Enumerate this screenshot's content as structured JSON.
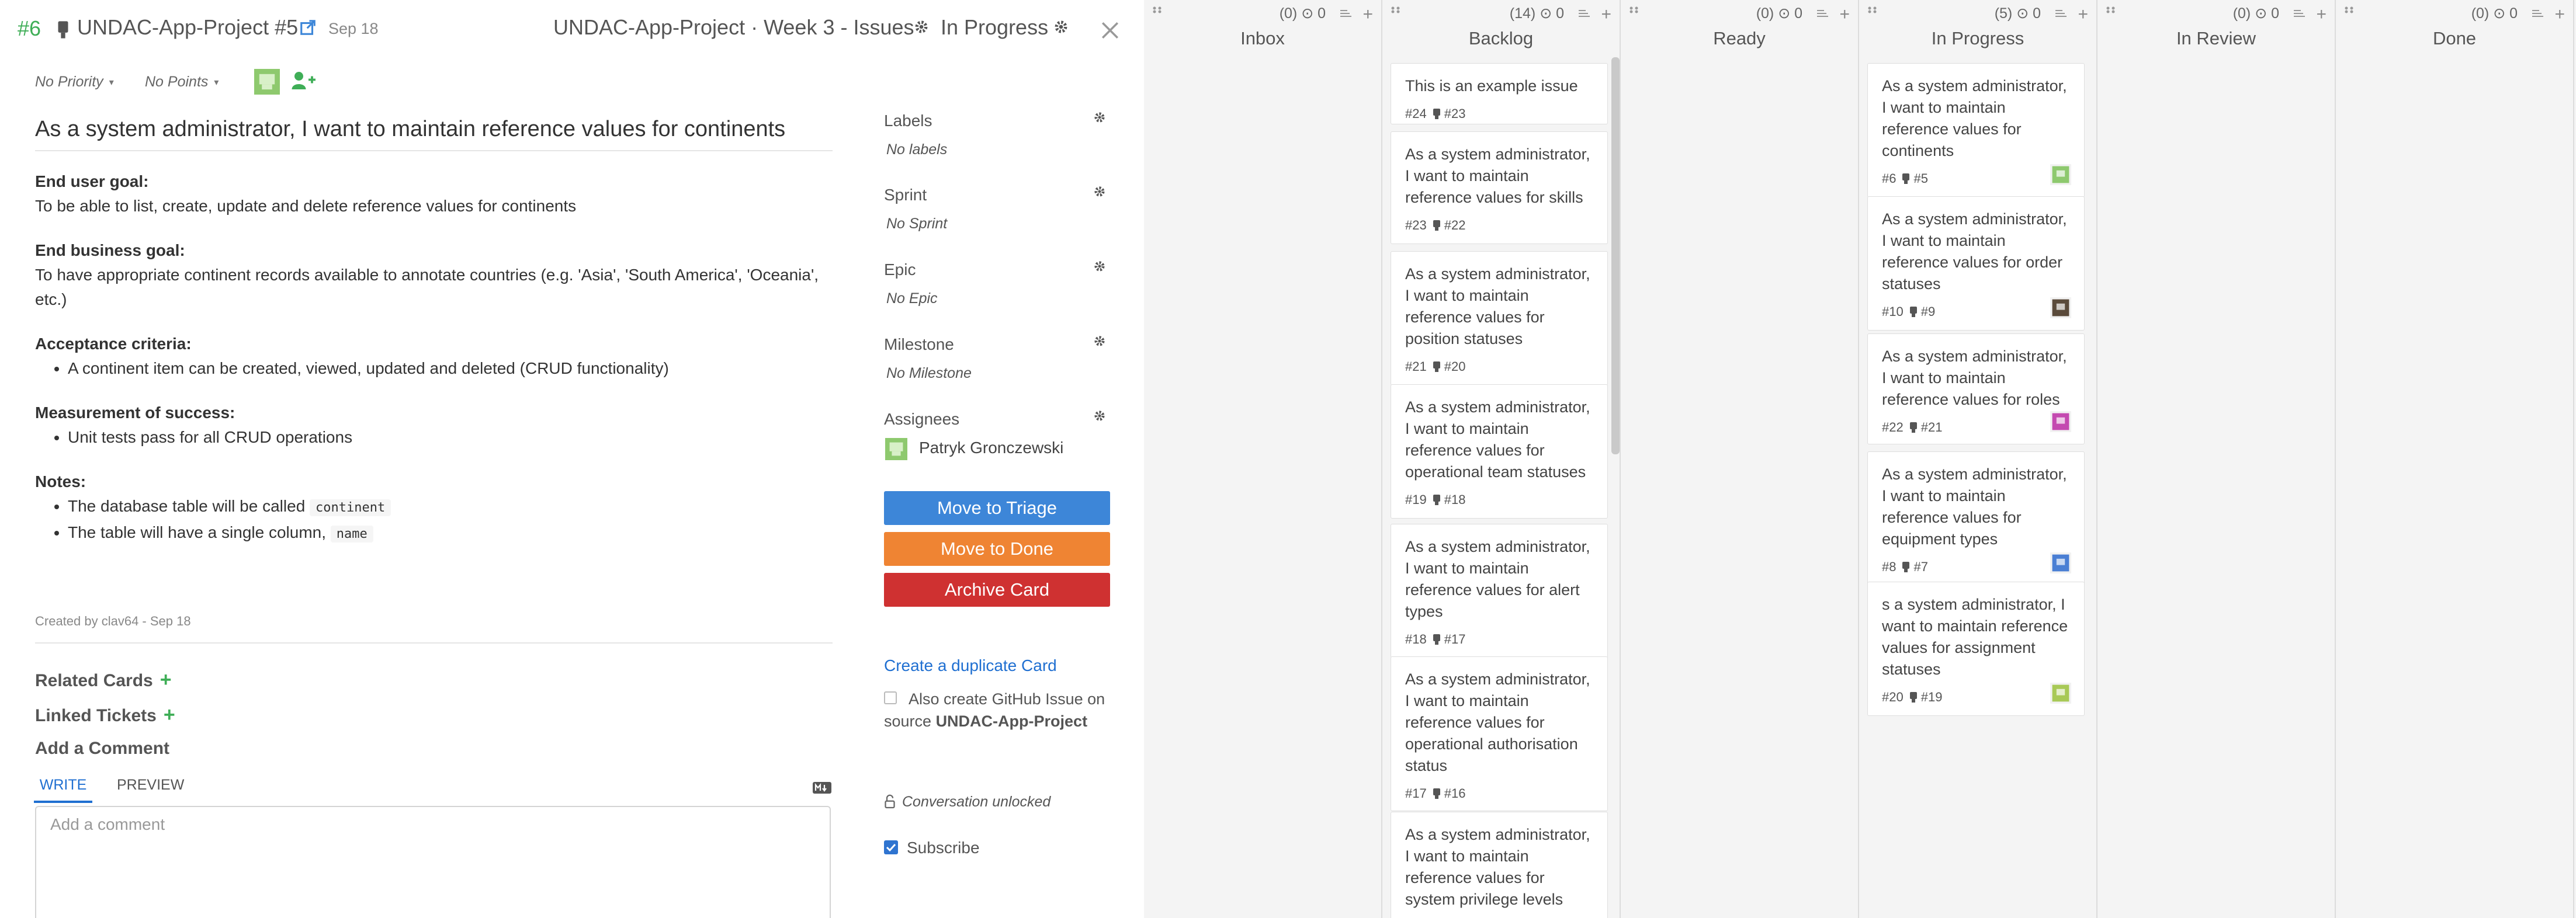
{
  "header": {
    "issue_number": "#6",
    "repo": "UNDAC-App-Project #5",
    "date": "Sep 18",
    "sprint": "UNDAC-App-Project · Week 3 - Issues",
    "status": "In Progress"
  },
  "meta": {
    "priority": "No Priority",
    "points": "No Points"
  },
  "issue": {
    "title": "As a system administrator, I want to maintain reference values for continents",
    "h_user_goal": "End user goal:",
    "user_goal": "To be able to list, create, update and delete reference values for continents",
    "h_business_goal": "End business goal:",
    "business_goal": "To have appropriate continent records available to annotate countries (e.g. 'Asia', 'South America', 'Oceania', etc.)",
    "h_acceptance": "Acceptance criteria:",
    "acceptance_1": "A continent item can be created, viewed, updated and deleted (CRUD functionality)",
    "h_measurement": "Measurement of success:",
    "measurement_1": "Unit tests pass for all CRUD operations",
    "h_notes": "Notes:",
    "note_1_text": "The database table will be called",
    "note_1_code": "continent",
    "note_2_text": "The table will have a single column,",
    "note_2_code": "name",
    "created": "Created by clav64 - Sep 18"
  },
  "sections": {
    "related": "Related Cards",
    "linked": "Linked Tickets",
    "add_comment": "Add a Comment"
  },
  "comment": {
    "tab_write": "WRITE",
    "tab_preview": "PREVIEW",
    "placeholder": "Add a comment"
  },
  "sidebar": {
    "labels_label": "Labels",
    "labels_value": "No labels",
    "sprint_label": "Sprint",
    "sprint_value": "No Sprint",
    "epic_label": "Epic",
    "epic_value": "No Epic",
    "milestone_label": "Milestone",
    "milestone_value": "No Milestone",
    "assignees_label": "Assignees",
    "assignee": "Patryk Gronczewski"
  },
  "actions": {
    "triage": "Move to Triage",
    "done": "Move to Done",
    "archive": "Archive Card",
    "duplicate": "Create a duplicate Card",
    "github_text": "Also create GitHub Issue on source",
    "github_repo": "UNDAC-App-Project",
    "unlocked": "Conversation unlocked",
    "subscribe": "Subscribe"
  },
  "colors": {
    "accent_green": "#3fae57",
    "link_blue": "#1f6fd1",
    "btn_blue": "#3d86d8",
    "btn_orange": "#ef8433",
    "btn_red": "#cf3131"
  },
  "columns": [
    {
      "name": "Inbox",
      "counts": "(0) ⊙ 0",
      "cards": []
    },
    {
      "name": "Backlog",
      "counts": "(14) ⊙ 0",
      "cards": [
        {
          "title": "This is an example issue",
          "num": "#24",
          "pr": "#23"
        },
        {
          "title": "As a system administrator, I want to maintain reference values for skills",
          "num": "#23",
          "pr": "#22"
        },
        {
          "title": "As a system administrator, I want to maintain reference values for position statuses",
          "num": "#21",
          "pr": "#20"
        },
        {
          "title": "As a system administrator, I want to maintain reference values for operational team statuses",
          "num": "#19",
          "pr": "#18"
        },
        {
          "title": "As a system administrator, I want to maintain reference values for alert types",
          "num": "#18",
          "pr": "#17"
        },
        {
          "title": "As a system administrator, I want to maintain reference values for operational authorisation status",
          "num": "#17",
          "pr": "#16"
        },
        {
          "title": "As a system administrator, I want to maintain reference values for system privilege levels",
          "num": "",
          "pr": ""
        }
      ]
    },
    {
      "name": "Ready",
      "counts": "(0) ⊙ 0",
      "cards": []
    },
    {
      "name": "In Progress",
      "counts": "(5) ⊙ 0",
      "cards": [
        {
          "title": "As a system administrator, I want to maintain reference values for continents",
          "num": "#6",
          "pr": "#5"
        },
        {
          "title": "As a system administrator, I want to maintain reference values for order statuses",
          "num": "#10",
          "pr": "#9"
        },
        {
          "title": "As a system administrator, I want to maintain reference values for roles",
          "num": "#22",
          "pr": "#21"
        },
        {
          "title": "As a system administrator, I want to maintain reference values for equipment types",
          "num": "#8",
          "pr": "#7"
        },
        {
          "title": "s a system administrator, I want to maintain reference values for assignment statuses",
          "num": "#20",
          "pr": "#19"
        }
      ]
    },
    {
      "name": "In Review",
      "counts": "(0) ⊙ 0",
      "cards": []
    },
    {
      "name": "Done",
      "counts": "(0) ⊙ 0",
      "cards": []
    }
  ]
}
